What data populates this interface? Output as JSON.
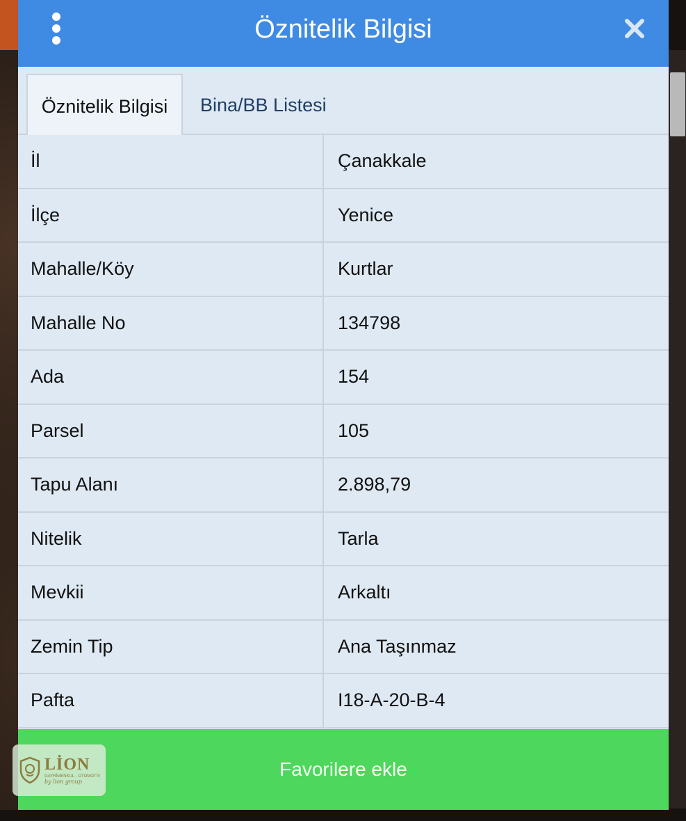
{
  "dialog": {
    "title": "Öznitelik Bilgisi"
  },
  "tabs": [
    {
      "label": "Öznitelik Bilgisi",
      "active": true
    },
    {
      "label": "Bina/BB Listesi",
      "active": false
    }
  ],
  "attributes": [
    {
      "key": "İl",
      "value": "Çanakkale"
    },
    {
      "key": "İlçe",
      "value": "Yenice"
    },
    {
      "key": "Mahalle/Köy",
      "value": "Kurtlar"
    },
    {
      "key": "Mahalle No",
      "value": "134798"
    },
    {
      "key": "Ada",
      "value": "154"
    },
    {
      "key": "Parsel",
      "value": "105"
    },
    {
      "key": "Tapu Alanı",
      "value": "2.898,79"
    },
    {
      "key": "Nitelik",
      "value": "Tarla"
    },
    {
      "key": "Mevkii",
      "value": "Arkaltı"
    },
    {
      "key": "Zemin Tip",
      "value": "Ana Taşınmaz"
    },
    {
      "key": "Pafta",
      "value": "I18-A-20-B-4"
    }
  ],
  "actions": {
    "favorite_label": "Favorilere ekle"
  },
  "logo": {
    "name": "LİON",
    "subtitle": "GAYRİMENKUL · OTOMOTİV",
    "tagline": "by lion group"
  },
  "icons": {
    "menu": "vertical-dots-icon",
    "close": "close-icon"
  },
  "colors": {
    "header": "#3f8be3",
    "button": "#4dd75c",
    "panel": "#dfe9f3"
  }
}
